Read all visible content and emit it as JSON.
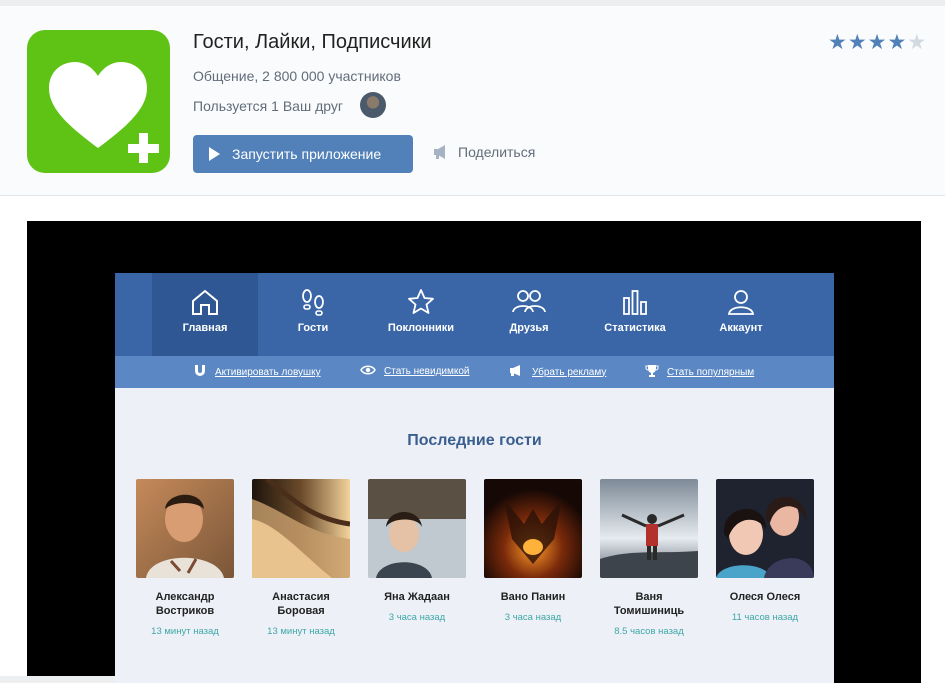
{
  "app": {
    "title": "Гости, Лайки, Подписчики",
    "subtitle": "Общение, 2 800 000 участников",
    "friends_text": "Пользуется 1 Ваш друг",
    "launch_label": "Запустить приложение",
    "share_label": "Поделиться",
    "rating": 4,
    "rating_max": 5,
    "icon": "heart-plus-icon",
    "colors": {
      "icon_bg": "#5fc315",
      "button": "#5181b8",
      "star_on": "#5181b8",
      "star_off": "#d3d9e0"
    }
  },
  "inner_app": {
    "nav": [
      {
        "label": "Главная",
        "icon": "home-icon",
        "active": true
      },
      {
        "label": "Гости",
        "icon": "footprints-icon",
        "active": false
      },
      {
        "label": "Поклонники",
        "icon": "star-icon",
        "active": false
      },
      {
        "label": "Друзья",
        "icon": "friends-icon",
        "active": false
      },
      {
        "label": "Статистика",
        "icon": "bar-chart-icon",
        "active": false
      },
      {
        "label": "Аккаунт",
        "icon": "user-icon",
        "active": false
      }
    ],
    "subnav": [
      {
        "label": "Активировать ловушку",
        "icon": "magnet-icon"
      },
      {
        "label": "Стать невидимкой",
        "icon": "eye-icon"
      },
      {
        "label": "Убрать рекламу",
        "icon": "megaphone-icon"
      },
      {
        "label": "Стать популярным",
        "icon": "trophy-icon"
      }
    ],
    "section_title": "Последние гости",
    "guests": [
      {
        "name": "Александр Востриков",
        "time": "13 минут назад"
      },
      {
        "name": "Анастасия Боровая",
        "time": "13 минут назад"
      },
      {
        "name": "Яна Жадаан",
        "time": "3 часа назад"
      },
      {
        "name": "Вано Панин",
        "time": "3 часа назад"
      },
      {
        "name": "Ваня Томишиниць",
        "time": "8.5 часов назад"
      },
      {
        "name": "Олеся Олеся",
        "time": "11 часов назад"
      }
    ]
  }
}
